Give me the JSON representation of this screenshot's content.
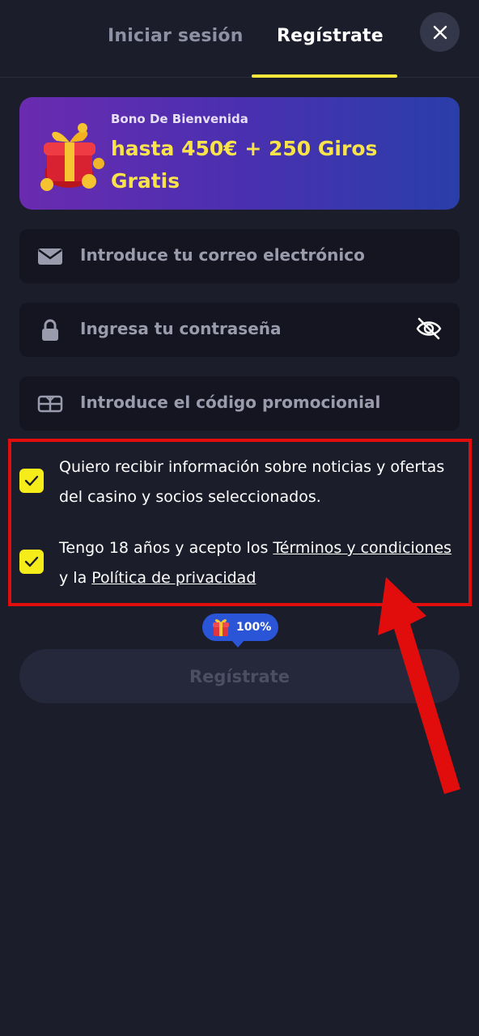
{
  "tabs": {
    "login": "Iniciar sesión",
    "register": "Regístrate"
  },
  "icons": {
    "close": "close-icon",
    "gift": "gift-icon",
    "email": "envelope-icon",
    "password": "lock-icon",
    "visibility": "eye-off-icon",
    "promo": "ticket-icon",
    "check": "check-icon"
  },
  "bonus": {
    "subtitle": "Bono De Bienvenida",
    "title": "hasta 450€ + 250 Giros Gratis"
  },
  "fields": {
    "email_placeholder": "Introduce tu correo electrónico",
    "password_placeholder": "Ingresa tu contraseña",
    "promo_placeholder": "Introduce el código promocionial"
  },
  "consents": {
    "marketing": {
      "checked": true,
      "text": "Quiero recibir información sobre noticias y ofertas del casino y socios seleccionados."
    },
    "terms": {
      "checked": true,
      "text_1": "Tengo 18 años y acepto los ",
      "link_terms": "Términos y condiciones",
      "text_2": " y la ",
      "link_privacy": "Política de privacidad"
    }
  },
  "progress": {
    "label": "100%",
    "value": 1.0
  },
  "submit": {
    "label": "Regístrate"
  },
  "colors": {
    "background": "#1c1d2b",
    "accent_yellow": "#f5ec1a",
    "tab_underline": "#f5e63a",
    "annotation_red": "#e10d0d",
    "progress_blue": "#2a55d6"
  }
}
